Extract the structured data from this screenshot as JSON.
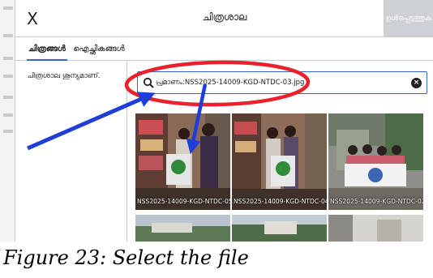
{
  "dialog": {
    "close_symbol": "X",
    "title": "ചിത്രശാല",
    "insert_label": "ഉൾപ്പെടുത്തുക"
  },
  "tabs": [
    {
      "label": "ചിത്രങ്ങൾ",
      "active": true
    },
    {
      "label": "ഐച്ഛികങ്ങൾ",
      "active": false
    }
  ],
  "sidebar": {
    "empty_text": "ചിത്രശാല ശൂന്യമാണ്."
  },
  "search": {
    "value": "പ്രമാണം:NSS2025-14009-KGD-NTDC-03.jpg",
    "clear_symbol": "×"
  },
  "results": [
    {
      "caption": "NSS2025-14009-KGD-NTDC-05"
    },
    {
      "caption": "NSS2025-14009-KGD-NTDC-04"
    },
    {
      "caption": "NSS2025-14009-KGD-NTDC-02"
    },
    {
      "caption": ""
    },
    {
      "caption": ""
    },
    {
      "caption": ""
    }
  ],
  "figure_caption": "Figure 23: Select the file",
  "colors": {
    "progressive_blue": "#3366cc",
    "annotation_red": "#e8212a",
    "annotation_blue": "#1f3ed8",
    "disabled_button": "#cdd1d6"
  }
}
